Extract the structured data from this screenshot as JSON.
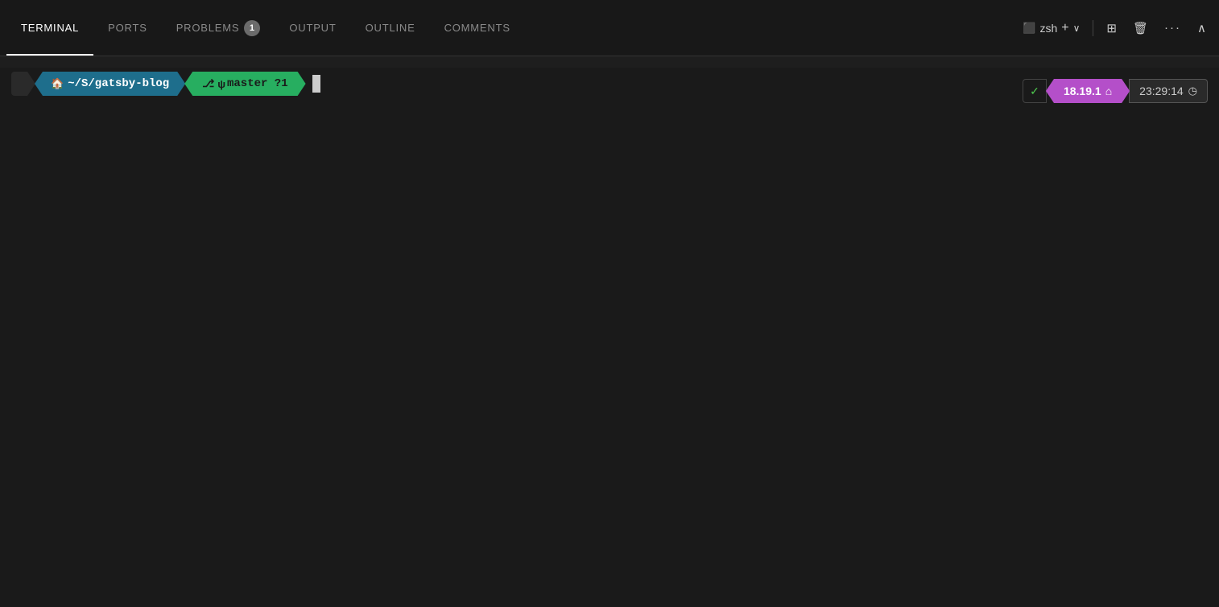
{
  "tabs": [
    {
      "id": "terminal",
      "label": "TERMINAL",
      "active": true,
      "badge": null
    },
    {
      "id": "ports",
      "label": "PORTS",
      "active": false,
      "badge": null
    },
    {
      "id": "problems",
      "label": "PROBLEMS",
      "active": false,
      "badge": "1"
    },
    {
      "id": "output",
      "label": "OUTPUT",
      "active": false,
      "badge": null
    },
    {
      "id": "outline",
      "label": "OUTLINE",
      "active": false,
      "badge": null
    },
    {
      "id": "comments",
      "label": "COMMENTS",
      "active": false,
      "badge": null
    }
  ],
  "toolbar": {
    "shell_icon": "⬜",
    "shell_label": "zsh",
    "add_icon": "+",
    "chevron_icon": "⌄",
    "split_icon": "⬜⬜",
    "trash_icon": "🗑",
    "more_icon": "···",
    "close_icon": "∧"
  },
  "prompt": {
    "apple_icon": "",
    "path_icon": "🏠",
    "path_label": "~/S/gatsby-blog",
    "git_icon": "⎇",
    "branch_icon": "ψ",
    "branch_label": "master ?1"
  },
  "status": {
    "check_icon": "✓",
    "node_version": "18.19.1",
    "node_icon": "⌂",
    "time": "23:29:14",
    "clock_icon": "◷"
  }
}
